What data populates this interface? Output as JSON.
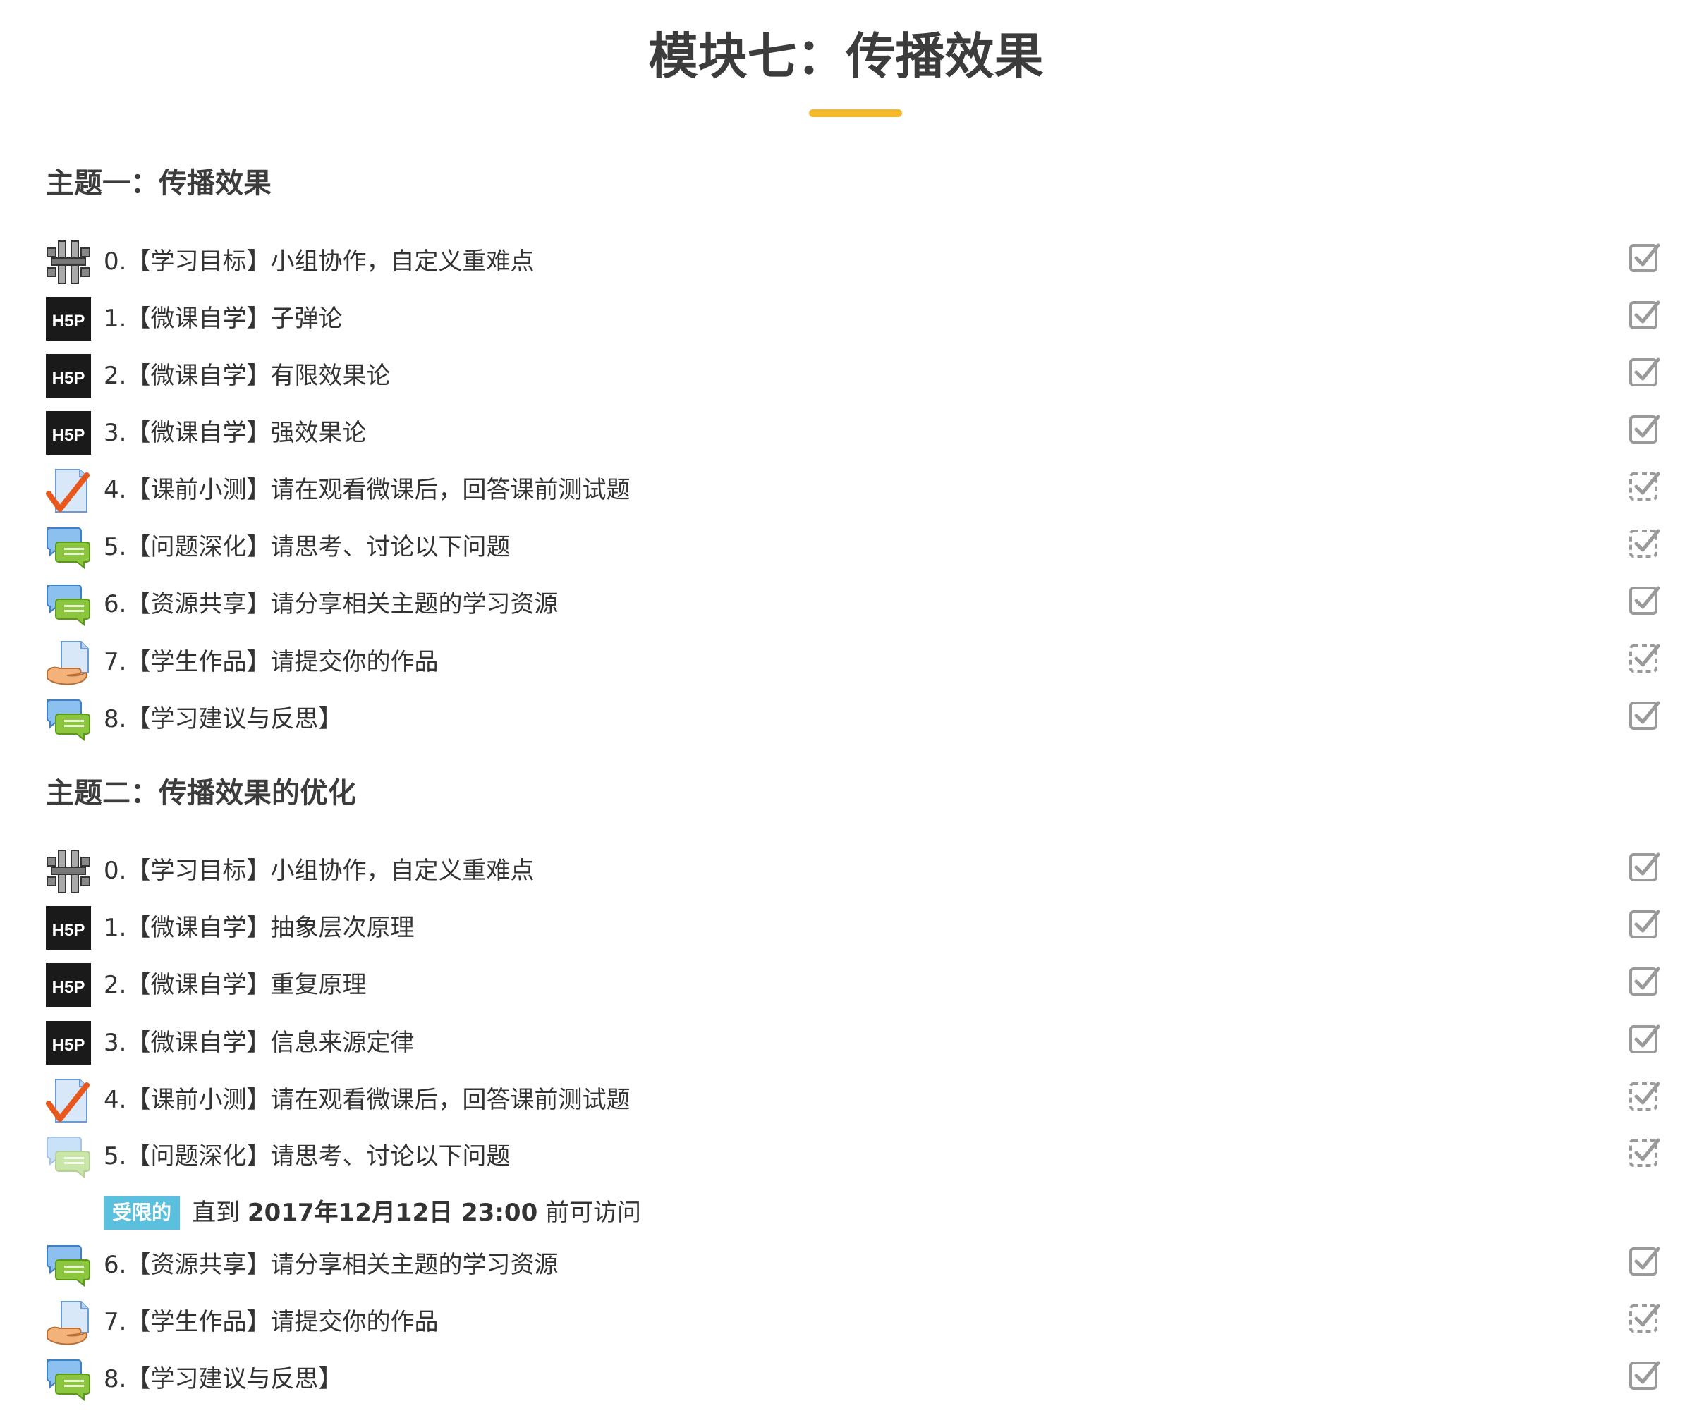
{
  "page": {
    "title": "模块七：传播效果"
  },
  "colors": {
    "accent_underline": "#f5b92c",
    "restricted_badge": "#5bc0de",
    "check_done": "#9a9a9a"
  },
  "sections": [
    {
      "title": "主题一：传播效果",
      "activities": [
        {
          "label": "0.【学习目标】小组协作，自定义重难点",
          "icon": "workshop-icon",
          "completion": "manual-done"
        },
        {
          "label": "1.【微课自学】子弹论",
          "icon": "h5p-icon",
          "completion": "manual-done"
        },
        {
          "label": "2.【微课自学】有限效果论",
          "icon": "h5p-icon",
          "completion": "manual-done"
        },
        {
          "label": "3.【微课自学】强效果论",
          "icon": "h5p-icon",
          "completion": "manual-done"
        },
        {
          "label": "4.【课前小测】请在观看微课后，回答课前测试题",
          "icon": "quiz-icon",
          "completion": "auto"
        },
        {
          "label": "5.【问题深化】请思考、讨论以下问题",
          "icon": "forum-icon",
          "completion": "auto"
        },
        {
          "label": "6.【资源共享】请分享相关主题的学习资源",
          "icon": "forum-icon",
          "completion": "manual-done"
        },
        {
          "label": "7.【学生作品】请提交你的作品",
          "icon": "assignment-icon",
          "completion": "auto"
        },
        {
          "label": "8.【学习建议与反思】",
          "icon": "forum-icon",
          "completion": "manual-done"
        }
      ]
    },
    {
      "title": "主题二：传播效果的优化",
      "activities": [
        {
          "label": "0.【学习目标】小组协作，自定义重难点",
          "icon": "workshop-icon",
          "completion": "manual-done"
        },
        {
          "label": "1.【微课自学】抽象层次原理",
          "icon": "h5p-icon",
          "completion": "manual-done"
        },
        {
          "label": "2.【微课自学】重复原理",
          "icon": "h5p-icon",
          "completion": "manual-done"
        },
        {
          "label": "3.【微课自学】信息来源定律",
          "icon": "h5p-icon",
          "completion": "manual-done"
        },
        {
          "label": "4.【课前小测】请在观看微课后，回答课前测试题",
          "icon": "quiz-icon",
          "completion": "auto"
        },
        {
          "label": "5.【问题深化】请思考、讨论以下问题",
          "icon": "forum-icon-dimmed",
          "completion": "auto"
        },
        {
          "label": "6.【资源共享】请分享相关主题的学习资源",
          "icon": "forum-icon",
          "completion": "manual-done"
        },
        {
          "label": "7.【学生作品】请提交你的作品",
          "icon": "assignment-icon",
          "completion": "auto"
        },
        {
          "label": "8.【学习建议与反思】",
          "icon": "forum-icon",
          "completion": "manual-done"
        }
      ],
      "restriction": {
        "badge": "受限的",
        "prefix": "直到",
        "date": "2017年12月12日 23:00",
        "suffix": "前可访问"
      }
    }
  ]
}
